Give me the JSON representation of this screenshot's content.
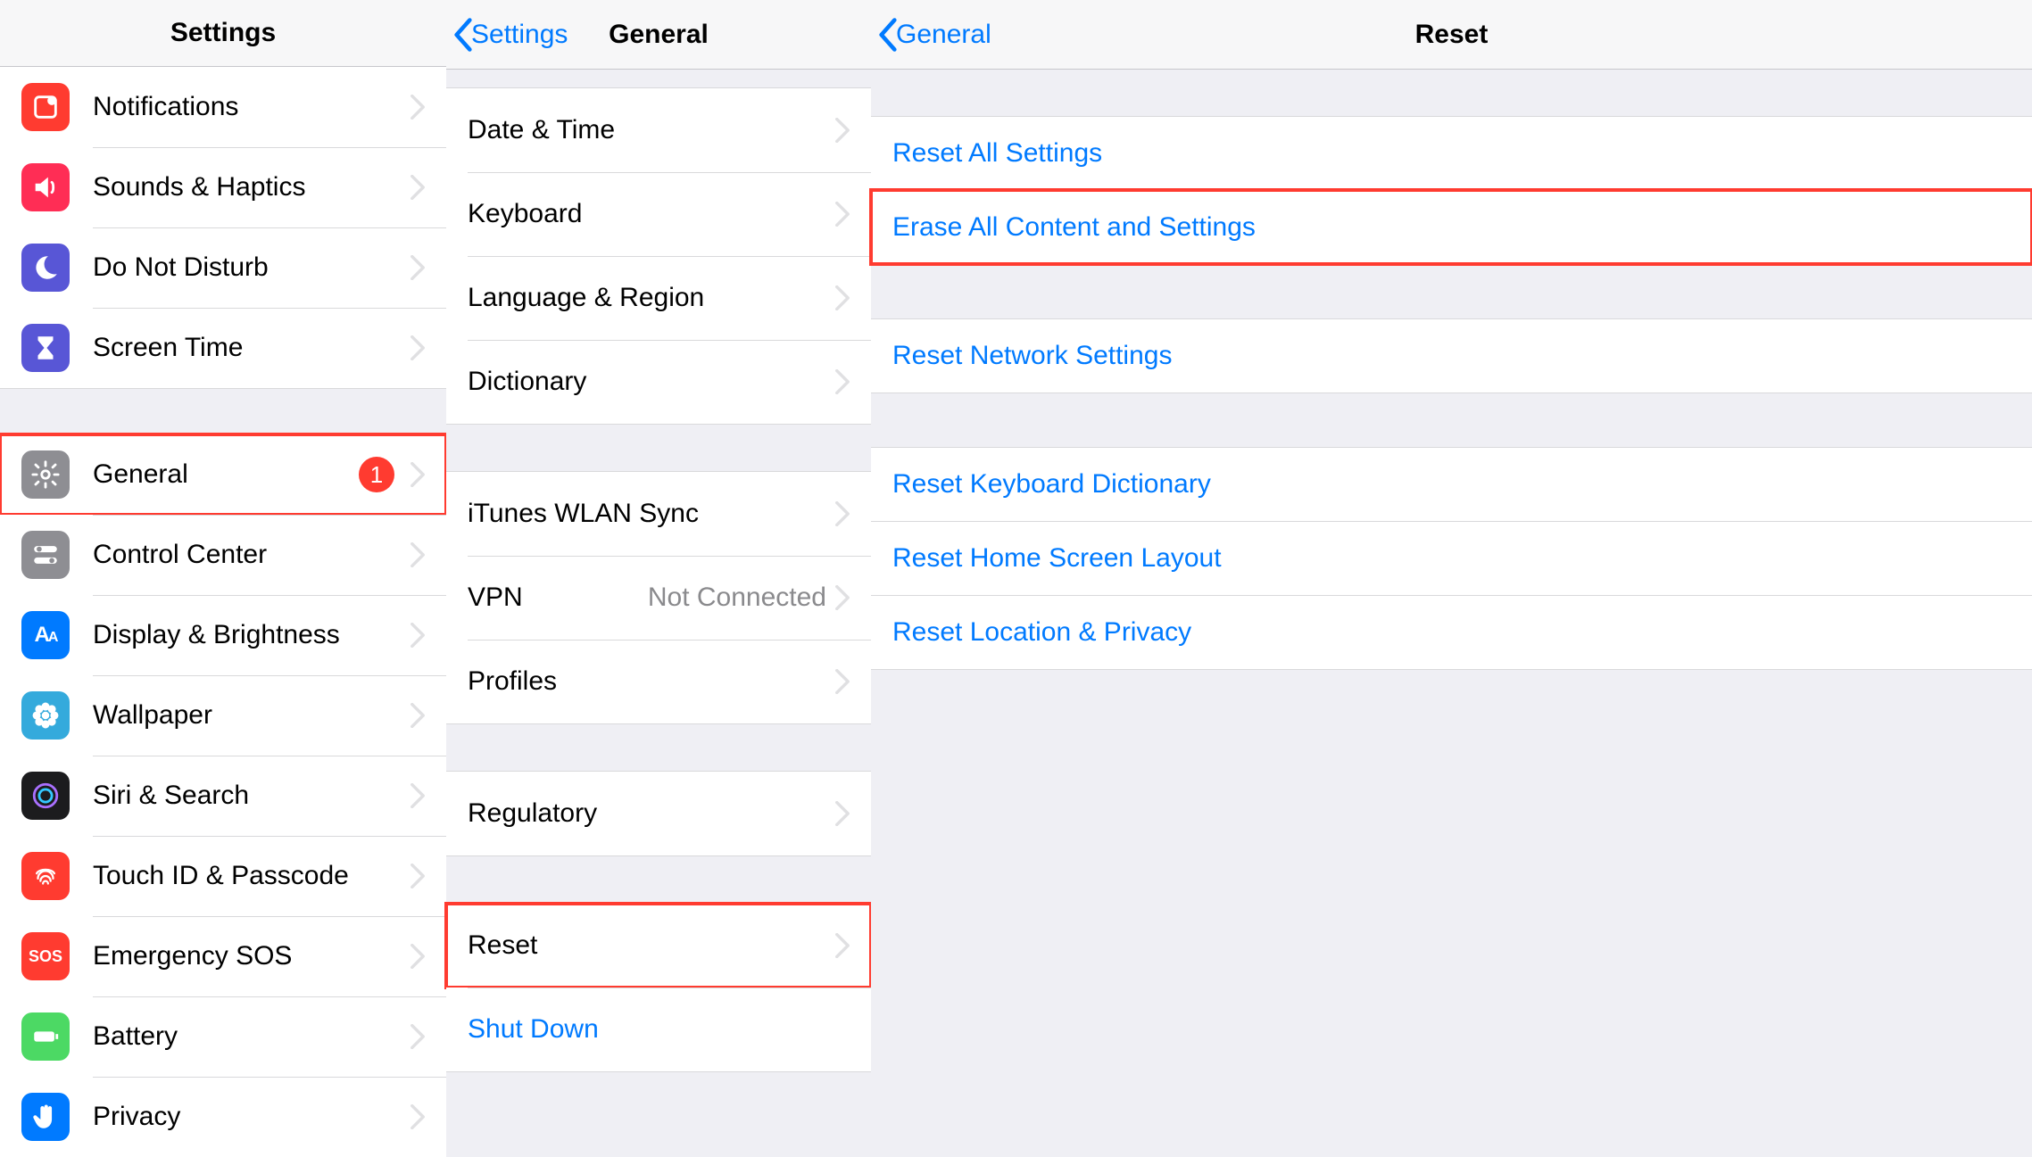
{
  "pane1": {
    "title": "Settings",
    "groups": [
      [
        {
          "id": "notifications",
          "label": "Notifications",
          "icon": "notifications-icon",
          "iconCls": "ic-red"
        },
        {
          "id": "sounds",
          "label": "Sounds & Haptics",
          "icon": "speaker-icon",
          "iconCls": "ic-pink"
        },
        {
          "id": "dnd",
          "label": "Do Not Disturb",
          "icon": "moon-icon",
          "iconCls": "ic-purple"
        },
        {
          "id": "screentime",
          "label": "Screen Time",
          "icon": "hourglass-icon",
          "iconCls": "ic-indigo"
        }
      ],
      [
        {
          "id": "general",
          "label": "General",
          "icon": "gear-icon",
          "iconCls": "ic-gray",
          "badge": "1",
          "highlight": true
        },
        {
          "id": "controlcenter",
          "label": "Control Center",
          "icon": "toggles-icon",
          "iconCls": "ic-gray"
        },
        {
          "id": "display",
          "label": "Display & Brightness",
          "icon": "text-size-icon",
          "iconCls": "ic-blue"
        },
        {
          "id": "wallpaper",
          "label": "Wallpaper",
          "icon": "flower-icon",
          "iconCls": "ic-cyan"
        },
        {
          "id": "siri",
          "label": "Siri & Search",
          "icon": "siri-icon",
          "iconCls": "ic-black"
        },
        {
          "id": "touchid",
          "label": "Touch ID & Passcode",
          "icon": "fingerprint-icon",
          "iconCls": "ic-orange"
        },
        {
          "id": "sos",
          "label": "Emergency SOS",
          "icon": "sos-icon",
          "iconCls": "ic-orange",
          "iconText": "SOS"
        },
        {
          "id": "battery",
          "label": "Battery",
          "icon": "battery-icon",
          "iconCls": "ic-green"
        },
        {
          "id": "privacy",
          "label": "Privacy",
          "icon": "hand-icon",
          "iconCls": "ic-hand"
        }
      ]
    ]
  },
  "pane2": {
    "back": "Settings",
    "title": "General",
    "groups": [
      [
        {
          "id": "datetime",
          "label": "Date & Time"
        },
        {
          "id": "keyboard",
          "label": "Keyboard"
        },
        {
          "id": "language",
          "label": "Language & Region"
        },
        {
          "id": "dictionary",
          "label": "Dictionary"
        }
      ],
      [
        {
          "id": "itunes",
          "label": "iTunes WLAN Sync"
        },
        {
          "id": "vpn",
          "label": "VPN",
          "value": "Not Connected"
        },
        {
          "id": "profiles",
          "label": "Profiles"
        }
      ],
      [
        {
          "id": "regulatory",
          "label": "Regulatory"
        }
      ],
      [
        {
          "id": "reset",
          "label": "Reset",
          "highlight": true
        },
        {
          "id": "shutdown",
          "label": "Shut Down",
          "blue": true,
          "noChevron": true
        }
      ]
    ]
  },
  "pane3": {
    "back": "General",
    "title": "Reset",
    "groups": [
      [
        {
          "id": "reset-all",
          "label": "Reset All Settings"
        },
        {
          "id": "erase-all",
          "label": "Erase All Content and Settings",
          "highlight": true
        }
      ],
      [
        {
          "id": "reset-network",
          "label": "Reset Network Settings"
        }
      ],
      [
        {
          "id": "reset-keyboard",
          "label": "Reset Keyboard Dictionary"
        },
        {
          "id": "reset-home",
          "label": "Reset Home Screen Layout"
        },
        {
          "id": "reset-location",
          "label": "Reset Location & Privacy"
        }
      ]
    ]
  }
}
